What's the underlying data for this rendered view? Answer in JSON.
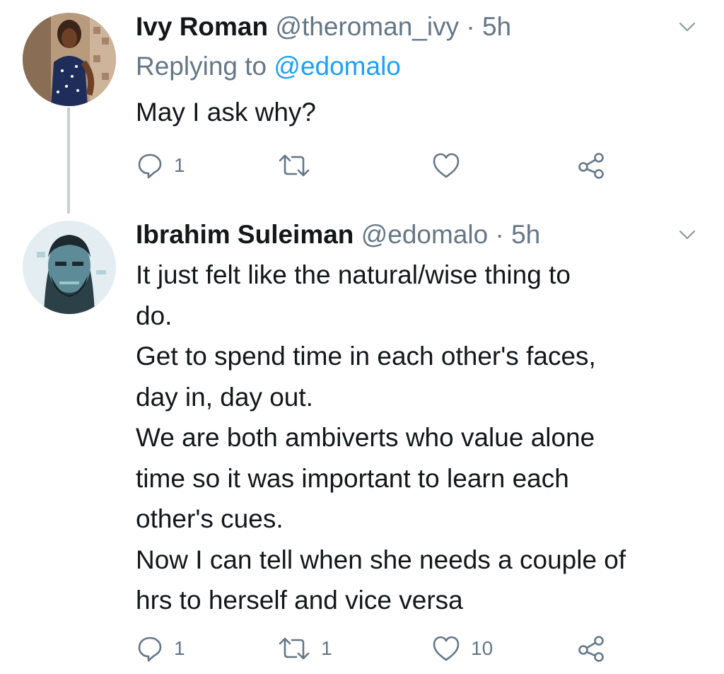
{
  "tweets": [
    {
      "name": "Ivy Roman",
      "handle": "@theroman_ivy",
      "time": "5h",
      "replying_label": "Replying to",
      "replying_to": "@edomalo",
      "lines": [
        "May I ask why?"
      ],
      "actions": {
        "reply": "1",
        "retweet": "",
        "like": "",
        "share": ""
      }
    },
    {
      "name": "Ibrahim Suleiman",
      "handle": "@edomalo",
      "time": "5h",
      "lines": [
        "It just felt like the natural/wise thing to",
        "do.",
        "Get to spend time in each other's faces,",
        "day in, day out.",
        "We are both ambiverts who value alone",
        "time so it was important to learn each",
        "other's cues.",
        "Now I can tell when she needs a couple of",
        "hrs to herself and vice versa"
      ],
      "actions": {
        "reply": "1",
        "retweet": "1",
        "like": "10",
        "share": ""
      }
    }
  ],
  "colors": {
    "text": "#14171a",
    "secondary": "#657786",
    "link": "#1da1f2",
    "thread_line": "#c8ced3"
  },
  "icons": {
    "reply": "reply-bubble-icon",
    "retweet": "retweet-icon",
    "like": "heart-icon",
    "share": "share-icon",
    "caret": "chevron-down-icon"
  }
}
